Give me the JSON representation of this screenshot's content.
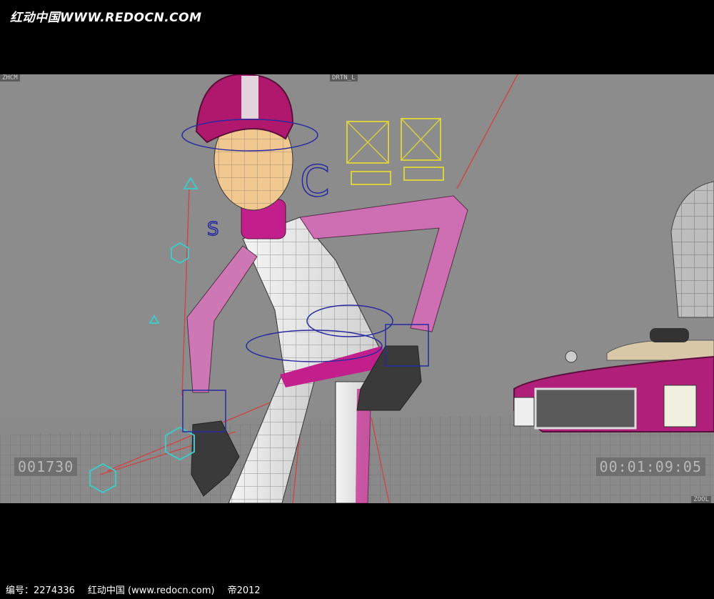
{
  "watermark": {
    "text": "红动中国WWW.REDOCN.COM"
  },
  "viewport": {
    "frame_counter": "001730",
    "timecode": "00:01:09:05",
    "corner_tag_left": "ZHCM",
    "corner_tag_top": "DRTN_L",
    "corner_tag_bottom_right": "ZOOL"
  },
  "footer": {
    "id_label": "编号：2274336",
    "site": "红动中国 (www.redocn.com)",
    "author": "帝2012"
  },
  "colors": {
    "letterbox": "#000000",
    "viewport_bg": "#8a8a8a",
    "suit_white": "#e8e8e8",
    "suit_magenta": "#c21e8c",
    "helmet": "#b0186e",
    "rig_red": "#c84a4a",
    "rig_blue": "#2a2aa0",
    "rig_yellow": "#d8d040",
    "rig_cyan": "#40c8c8"
  },
  "icons": [
    "character-model",
    "car-model",
    "rig-controllers",
    "joint-handles"
  ]
}
